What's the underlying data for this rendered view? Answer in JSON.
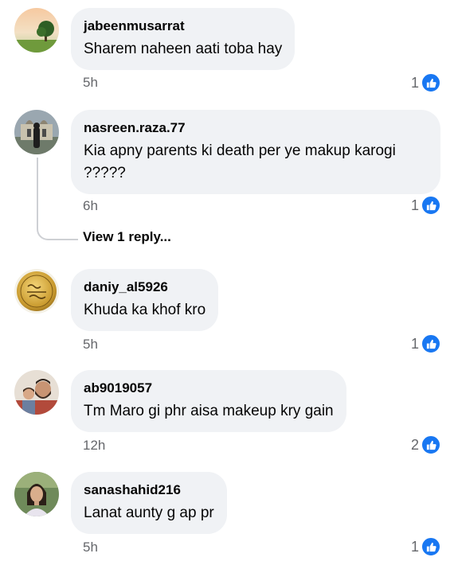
{
  "comments": [
    {
      "author": "jabeenmusarrat",
      "text": "Sharem naheen aati toba hay",
      "time": "5h",
      "likes": "1",
      "avatar_icon": "landscape-tree-avatar"
    },
    {
      "author": "nasreen.raza.77",
      "text": "Kia apny parents ki death per ye makup karogi ?????",
      "time": "6h",
      "likes": "1",
      "avatar_icon": "mosque-avatar"
    },
    {
      "author": "daniy_al5926",
      "text": "Khuda ka khof kro",
      "time": "5h",
      "likes": "1",
      "avatar_icon": "gold-seal-avatar"
    },
    {
      "author": "ab9019057",
      "text": "Tm Maro gi phr aisa makeup kry gain",
      "time": "12h",
      "likes": "2",
      "avatar_icon": "family-photo-avatar"
    },
    {
      "author": "sanashahid216",
      "text": "Lanat aunty g ap  pr",
      "time": "5h",
      "likes": "1",
      "avatar_icon": "girl-photo-avatar"
    }
  ],
  "view_replies_label": "View 1 reply...",
  "colors": {
    "like_blue": "#1877f2",
    "bubble_bg": "#f0f2f5",
    "meta_gray": "#65676b"
  }
}
